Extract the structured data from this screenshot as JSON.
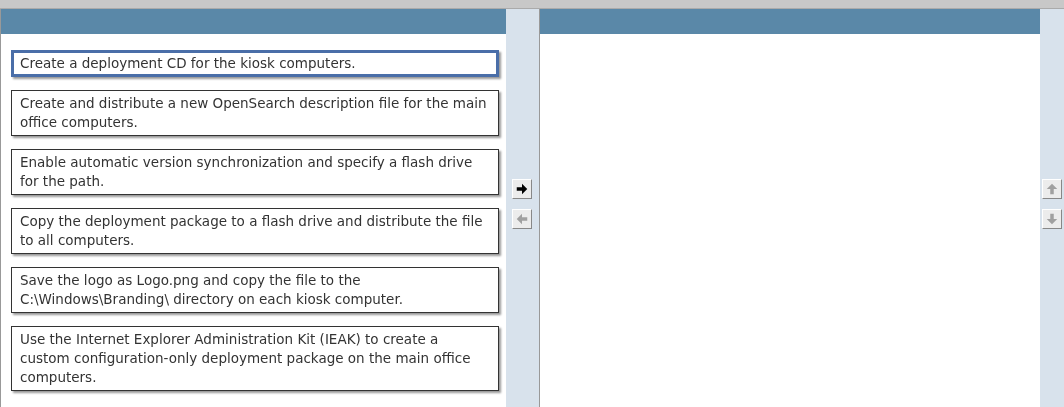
{
  "answer_choices": [
    {
      "text": "Create a deployment CD for the kiosk computers.",
      "selected": true
    },
    {
      "text": "Create and distribute a new OpenSearch description file for the main office computers.",
      "selected": false
    },
    {
      "text": "Enable automatic version synchronization and specify a flash drive for the path.",
      "selected": false
    },
    {
      "text": "Copy the deployment package to a flash drive and distribute the file to all computers.",
      "selected": false
    },
    {
      "text": "Save the logo as Logo.png and copy the file to the C:\\Windows\\Branding\\ directory on each kiosk computer.",
      "selected": false
    },
    {
      "text": "Use the Internet Explorer Administration Kit (IEAK) to create a custom configuration-only deployment package on the main office computers.",
      "selected": false
    }
  ],
  "move_buttons": [
    {
      "kind": "right",
      "disabled": false
    },
    {
      "kind": "left",
      "disabled": true
    }
  ],
  "order_buttons": [
    {
      "kind": "up",
      "disabled": true
    },
    {
      "kind": "down",
      "disabled": true
    }
  ]
}
